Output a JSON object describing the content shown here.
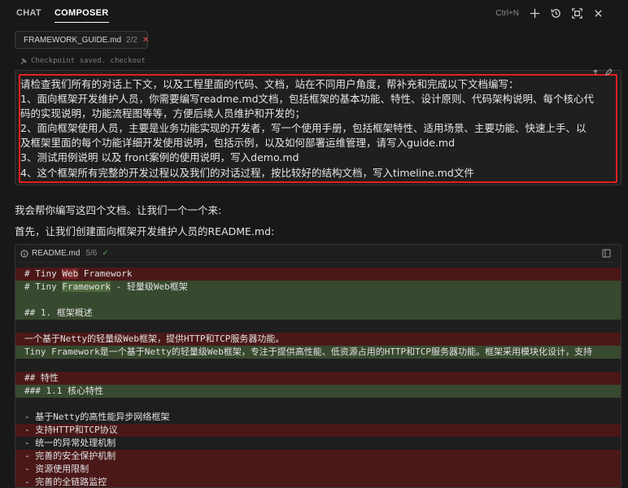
{
  "tabs": [
    {
      "label": "CHAT",
      "active": false
    },
    {
      "label": "COMPOSER",
      "active": true
    }
  ],
  "top_actions": {
    "shortcut": "Ctrl+N",
    "icons": [
      "plus-icon",
      "history-icon",
      "maximize-icon",
      "close-icon"
    ]
  },
  "file_chip": {
    "name": "FRAMEWORK_GUIDE.md",
    "count": "2/2"
  },
  "checkpoint": {
    "text": "Checkpoint saved. checkout"
  },
  "user_message": {
    "lines": [
      "请检查我们所有的对话上下文，以及工程里面的代码、文档，站在不同用户角度，帮补充和完成以下文档编写：",
      "1、面向框架开发维护人员，你需要编写readme.md文档，包括框架的基本功能、特性、设计原则、代码架构说明、每个核心代",
      "码的实现说明，功能流程图等等，方便后续人员维护和开发的；",
      "2、面向框架使用人员，主要是业务功能实现的开发者，写一个使用手册，包括框架特性、适用场景、主要功能、快速上手、以",
      "及框架里面的每个功能详细开发使用说明，包括示例，以及如何部署运维管理，请写入guide.md",
      "3、测试用例说明 以及 front案例的使用说明，写入demo.md",
      "4、这个框架所有完整的开发过程以及我们的对话过程，按比较好的结构文档，写入timeline.md文件"
    ]
  },
  "assistant": {
    "line1": "我会帮你编写这四个文档。让我们一个一个来:",
    "line2": "首先，让我们创建面向框架开发维护人员的README.md:"
  },
  "code_block": {
    "filename": "README.md",
    "meta": "5/6",
    "check": "✓",
    "lines": [
      {
        "type": "del",
        "parts": [
          {
            "t": "# Tiny "
          },
          {
            "t": "Web",
            "hl": true
          },
          {
            "t": " Framework"
          }
        ]
      },
      {
        "type": "add",
        "parts": [
          {
            "t": "# Tiny "
          },
          {
            "t": "Framework",
            "hl": true
          },
          {
            "t": " - 轻量级Web框架"
          }
        ]
      },
      {
        "type": "add",
        "parts": [
          {
            "t": ""
          }
        ]
      },
      {
        "type": "add",
        "parts": [
          {
            "t": "## 1. 框架概述"
          }
        ]
      },
      {
        "type": "blank",
        "parts": [
          {
            "t": ""
          }
        ]
      },
      {
        "type": "del",
        "parts": [
          {
            "t": "一个基于Netty的轻量级Web框架，提供HTTP和TCP服务器功能。"
          }
        ]
      },
      {
        "type": "add",
        "parts": [
          {
            "t": "Tiny Framework是一个基于Netty的轻量级Web框架，专注于提供高性能、低资源占用的HTTP和TCP服务器功能。框架采用模块化设计，支持"
          }
        ]
      },
      {
        "type": "blank",
        "parts": [
          {
            "t": ""
          }
        ]
      },
      {
        "type": "del",
        "parts": [
          {
            "t": "## 特性"
          }
        ]
      },
      {
        "type": "add",
        "parts": [
          {
            "t": "### 1.1 核心特性"
          }
        ]
      },
      {
        "type": "blank",
        "parts": [
          {
            "t": ""
          }
        ]
      },
      {
        "type": "blank",
        "parts": [
          {
            "t": "- 基于Netty的高性能异步网络框架"
          }
        ]
      },
      {
        "type": "del",
        "parts": [
          {
            "t": "- 支持HTTP和TCP协议"
          }
        ]
      },
      {
        "type": "blank",
        "parts": [
          {
            "t": "- 统一的异常处理机制"
          }
        ]
      },
      {
        "type": "del",
        "parts": [
          {
            "t": "- 完善的安全保护机制"
          }
        ]
      },
      {
        "type": "del",
        "parts": [
          {
            "t": "- 资源使用限制"
          }
        ]
      },
      {
        "type": "del",
        "parts": [
          {
            "t": "- 完善的全链路监控"
          }
        ]
      }
    ]
  }
}
